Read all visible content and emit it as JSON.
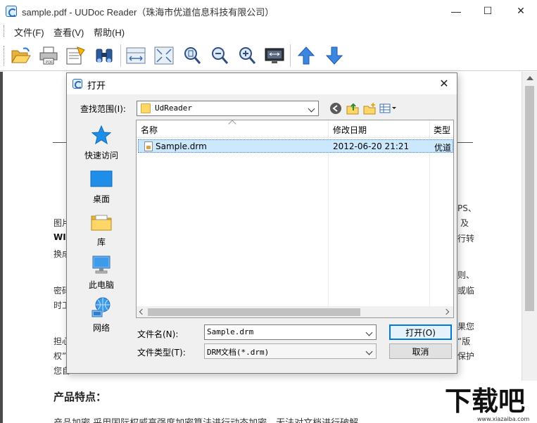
{
  "window": {
    "title": "sample.pdf - UUDoc Reader（珠海市优道信息科技有限公司）",
    "minimize": "—",
    "maximize": "☐",
    "close": "✕"
  },
  "menu": [
    "文件(F)",
    "查看(V)",
    "帮助(H)"
  ],
  "toolbar_icons": [
    "open-icon",
    "print-icon",
    "properties-icon",
    "find-icon",
    "fit-width-icon",
    "fit-page-icon",
    "zoom-actual-icon",
    "zoom-out-icon",
    "zoom-in-icon",
    "fullscreen-icon",
    "previous-page-icon",
    "next-page-icon"
  ],
  "document": {
    "left_fragments": [
      "图片",
      "WI",
      "换成",
      "密码",
      "时工",
      "担心",
      "权”",
      "您自"
    ],
    "right_fragments": [
      "PS、",
      "及",
      "行转",
      "则、",
      "或临",
      "果您",
      "“版",
      "保护"
    ],
    "heading": "产品特点：",
    "cut_line": "产品加密   采用国际权威高强度加密算法进行动态加密，无法对文档进行破解"
  },
  "dialog": {
    "title": "打开",
    "close": "✕",
    "lookin_label": "查找范围(I):",
    "lookin_value": "UdReader",
    "places": [
      {
        "label": "快速访问",
        "icon": "quick-access-icon"
      },
      {
        "label": "桌面",
        "icon": "desktop-icon"
      },
      {
        "label": "库",
        "icon": "library-icon"
      },
      {
        "label": "此电脑",
        "icon": "this-pc-icon"
      },
      {
        "label": "网络",
        "icon": "network-icon"
      }
    ],
    "columns": [
      "名称",
      "修改日期",
      "类型"
    ],
    "files": [
      {
        "name": "Sample.drm",
        "date": "2012-06-20 21:21",
        "type": "优道"
      }
    ],
    "filename_label": "文件名(N):",
    "filename_value": "Sample.drm",
    "filetype_label": "文件类型(T):",
    "filetype_value": "DRM文档(*.drm)",
    "open_button": "打开(O)",
    "cancel_button": "取消"
  },
  "watermark": {
    "text": "下载吧",
    "url": "www.xiazaiba.com"
  }
}
